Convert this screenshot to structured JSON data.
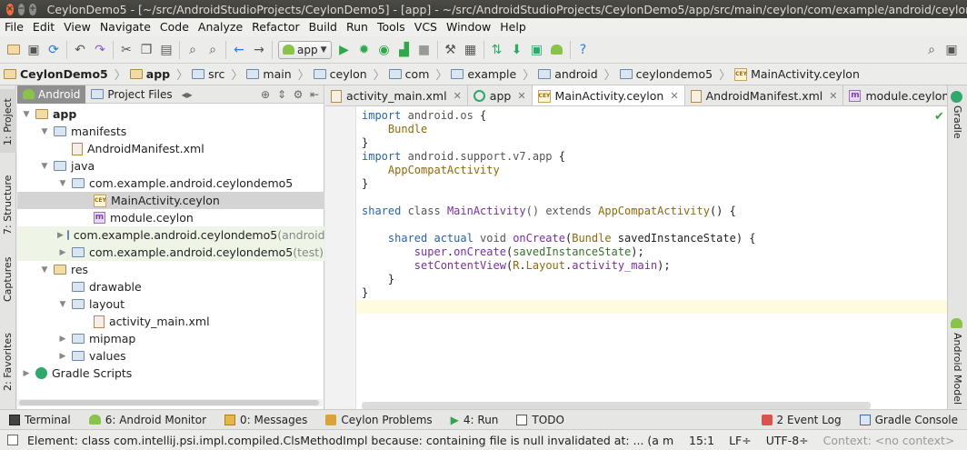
{
  "window": {
    "title": "CeylonDemo5 - [~/src/AndroidStudioProjects/CeylonDemo5] - [app] - ~/src/AndroidStudioProjects/CeylonDemo5/app/src/main/ceylon/com/example/android/ceylondemo5/Main..."
  },
  "menu": {
    "items": [
      "File",
      "Edit",
      "View",
      "Navigate",
      "Code",
      "Analyze",
      "Refactor",
      "Build",
      "Run",
      "Tools",
      "VCS",
      "Window",
      "Help"
    ]
  },
  "toolbar": {
    "run_config": "app",
    "icons": [
      "open-folder",
      "save-all",
      "sync",
      "undo",
      "redo",
      "cut",
      "copy",
      "paste",
      "find",
      "replace",
      "back",
      "forward",
      "run-config",
      "run",
      "debug",
      "coverage",
      "attach",
      "stop",
      "project-structure",
      "sdk-manager",
      "avd-manager",
      "sync-gradle",
      "android-monitor",
      "help",
      "search"
    ]
  },
  "breadcrumbs": [
    "CeylonDemo5",
    "app",
    "src",
    "main",
    "ceylon",
    "com",
    "example",
    "android",
    "ceylondemo5",
    "MainActivity.ceylon"
  ],
  "left_tools": [
    "1: Project",
    "7: Structure",
    "Captures",
    "2: Favorites"
  ],
  "right_tools": [
    "Gradle",
    "Android Model"
  ],
  "project_panel": {
    "tabs": [
      "Android",
      "Project Files"
    ],
    "tree": [
      {
        "label": "app",
        "suffix": "",
        "icon": "folder"
      },
      {
        "label": "manifests",
        "suffix": "",
        "icon": "folder"
      },
      {
        "label": "AndroidManifest.xml",
        "suffix": "",
        "icon": "xml"
      },
      {
        "label": "java",
        "suffix": "",
        "icon": "folder"
      },
      {
        "label": "com.example.android.ceylondemo5",
        "suffix": "",
        "icon": "folder"
      },
      {
        "label": "MainActivity.ceylon",
        "suffix": "",
        "icon": "cey"
      },
      {
        "label": "module.ceylon",
        "suffix": "",
        "icon": "m"
      },
      {
        "label": "com.example.android.ceylondemo5",
        "suffix": " (androidTe",
        "icon": "folder"
      },
      {
        "label": "com.example.android.ceylondemo5",
        "suffix": " (test)",
        "icon": "folder"
      },
      {
        "label": "res",
        "suffix": "",
        "icon": "folder"
      },
      {
        "label": "drawable",
        "suffix": "",
        "icon": "folder"
      },
      {
        "label": "layout",
        "suffix": "",
        "icon": "folder"
      },
      {
        "label": "activity_main.xml",
        "suffix": "",
        "icon": "xml"
      },
      {
        "label": "mipmap",
        "suffix": "",
        "icon": "folder"
      },
      {
        "label": "values",
        "suffix": "",
        "icon": "folder"
      },
      {
        "label": "Gradle Scripts",
        "suffix": "",
        "icon": "gradle"
      }
    ]
  },
  "editor_tabs": [
    "activity_main.xml",
    "app",
    "MainActivity.ceylon",
    "AndroidManifest.xml",
    "module.ceylon"
  ],
  "code": {
    "l1a": "import ",
    "l1b": "android.os",
    " l1c": " {",
    "l2": "Bundle",
    "l3": "}",
    "l4a": "import ",
    "l4b": "android.support.v7.app",
    "l4c": " {",
    "l5": "AppCompatActivity",
    "l6": "}",
    "l8a": "shared",
    "l8b": " class ",
    "l8c": "MainActivity",
    "l8d": "() extends ",
    "l8e": "AppCompatActivity",
    "l8f": "() {",
    "l10a": "shared actual",
    "l10b": " void ",
    "l10c": "onCreate",
    "l10d": "(",
    "l10e": "Bundle",
    "l10f": " savedInstanceState) {",
    "l11a": "super",
    "l11b": ".",
    "l11c": "onCreate",
    "l11d": "(",
    "l11e": "savedInstanceState",
    "l11f": ");",
    "l12a": "setContentView",
    "l12b": "(",
    "l12c": "R",
    "l12d": ".",
    "l12e": "Layout",
    "l12f": ".",
    "l12g": "activity_main",
    "l12h": ");",
    "l13": "}",
    "l14": "}"
  },
  "bottom_tools": [
    "Terminal",
    "6: Android Monitor",
    "0: Messages",
    "Ceylon Problems",
    "4: Run",
    "TODO",
    "2 Event Log",
    "Gradle Console"
  ],
  "status": {
    "message": "Element: class com.intellij.psi.impl.compiled.ClsMethodImpl because: containing file is null invalidated at: ... (a minute ago)",
    "position": "15:1",
    "line_sep": "LF÷",
    "encoding": "UTF-8÷",
    "context": "Context: <no context>"
  }
}
